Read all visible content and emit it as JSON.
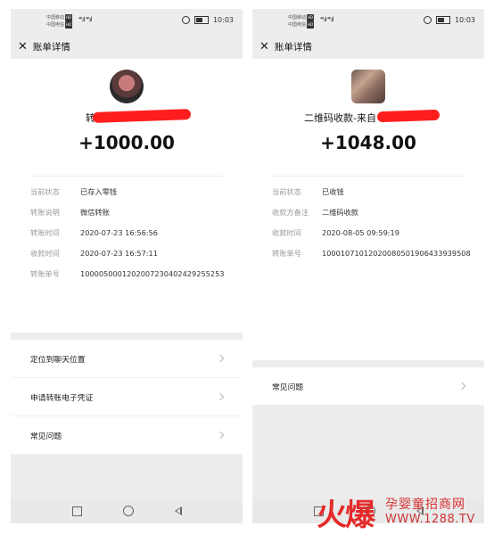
{
  "left": {
    "status": {
      "carrier1": "中国移动",
      "carrier2": "中国电信",
      "hd": "HD",
      "signal": "⁴⁶.ıl ⁴⁶.ıl",
      "time": "10:03"
    },
    "nav": {
      "title": "账单详情"
    },
    "payer_name": "转",
    "amount": "+1000.00",
    "details": [
      {
        "label": "当前状态",
        "value": "已存入零钱"
      },
      {
        "label": "转账说明",
        "value": "微信转账"
      },
      {
        "label": "转账时间",
        "value": "2020-07-23 16:56:56"
      },
      {
        "label": "收款时间",
        "value": "2020-07-23 16:57:11"
      },
      {
        "label": "转账单号",
        "value": "1000050001202007230402429255253"
      }
    ],
    "menu": [
      {
        "label": "定位到聊天位置"
      },
      {
        "label": "申请转账电子凭证"
      },
      {
        "label": "常见问题"
      }
    ]
  },
  "right": {
    "status": {
      "carrier1": "中国移动",
      "carrier2": "中国电信",
      "hd": "HD",
      "signal": "⁴⁶.ıl ⁴⁶.ıl",
      "time": "10:03"
    },
    "nav": {
      "title": "账单详情"
    },
    "payer_name": "二维码收款-来自",
    "amount": "+1048.00",
    "details": [
      {
        "label": "当前状态",
        "value": "已收钱"
      },
      {
        "label": "收款方备注",
        "value": "二维码收款"
      },
      {
        "label": "收款时间",
        "value": "2020-08-05 09:59:19"
      },
      {
        "label": "转账单号",
        "value": "100010710120200805019064339395​08"
      }
    ],
    "menu": [
      {
        "label": "常见问题"
      }
    ]
  },
  "watermark": {
    "brand": "火爆",
    "site_name": "孕婴童招商网",
    "url": "WWW.1288.TV"
  },
  "colors": {
    "redaction": "#ff1e1e",
    "watermark": "#e52a2a"
  }
}
